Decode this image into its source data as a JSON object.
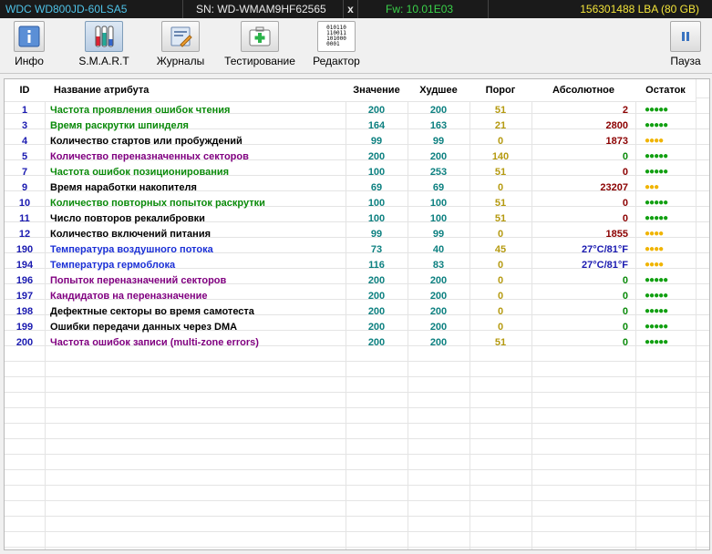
{
  "status_bar": {
    "model": "WDC WD800JD-60LSA5",
    "serial": "SN: WD-WMAM9HF62565",
    "close": "x",
    "firmware": "Fw: 10.01E03",
    "capacity": "156301488 LBA (80 GB)"
  },
  "toolbar": {
    "info": "Инфо",
    "smart": "S.M.A.R.T",
    "journals": "Журналы",
    "testing": "Тестирование",
    "editor": "Редактор",
    "pause": "Пауза",
    "editor_icon_text": [
      "010110",
      "110011",
      "101000",
      "0001"
    ]
  },
  "table": {
    "headers": {
      "id": "ID",
      "name": "Название атрибута",
      "value": "Значение",
      "worst": "Худшее",
      "threshold": "Порог",
      "raw": "Абсолютное",
      "remaining": "Остаток"
    },
    "rows": [
      {
        "id": "1",
        "name": "Частота проявления ошибок чтения",
        "value": "200",
        "worst": "200",
        "threshold": "51",
        "raw": "2",
        "remaining": "●●●●●",
        "name_color": "green",
        "raw_style": "red",
        "rem_color": "green"
      },
      {
        "id": "3",
        "name": "Время раскрутки шпинделя",
        "value": "164",
        "worst": "163",
        "threshold": "21",
        "raw": "2800",
        "remaining": "●●●●●",
        "name_color": "green",
        "raw_style": "red",
        "rem_color": "green"
      },
      {
        "id": "4",
        "name": "Количество стартов или пробуждений",
        "value": "99",
        "worst": "99",
        "threshold": "0",
        "raw": "1873",
        "remaining": "●●●●",
        "name_color": "black",
        "raw_style": "red",
        "rem_color": "yellow"
      },
      {
        "id": "5",
        "name": "Количество переназначенных секторов",
        "value": "200",
        "worst": "200",
        "threshold": "140",
        "raw": "0",
        "remaining": "●●●●●",
        "name_color": "purple",
        "raw_style": "ok",
        "rem_color": "green"
      },
      {
        "id": "7",
        "name": "Частота ошибок позиционирования",
        "value": "100",
        "worst": "253",
        "threshold": "51",
        "raw": "0",
        "remaining": "●●●●●",
        "name_color": "green",
        "raw_style": "red",
        "rem_color": "green"
      },
      {
        "id": "9",
        "name": "Время наработки накопителя",
        "value": "69",
        "worst": "69",
        "threshold": "0",
        "raw": "23207",
        "remaining": "●●●",
        "name_color": "black",
        "raw_style": "red",
        "rem_color": "yellow"
      },
      {
        "id": "10",
        "name": "Количество повторных попыток раскрутки",
        "value": "100",
        "worst": "100",
        "threshold": "51",
        "raw": "0",
        "remaining": "●●●●●",
        "name_color": "green",
        "raw_style": "red",
        "rem_color": "green"
      },
      {
        "id": "11",
        "name": "Число повторов рекалибровки",
        "value": "100",
        "worst": "100",
        "threshold": "51",
        "raw": "0",
        "remaining": "●●●●●",
        "name_color": "black",
        "raw_style": "red",
        "rem_color": "green"
      },
      {
        "id": "12",
        "name": "Количество включений питания",
        "value": "99",
        "worst": "99",
        "threshold": "0",
        "raw": "1855",
        "remaining": "●●●●",
        "name_color": "black",
        "raw_style": "red",
        "rem_color": "yellow"
      },
      {
        "id": "190",
        "name": "Температура воздушного потока",
        "value": "73",
        "worst": "40",
        "threshold": "45",
        "raw": "27°C/81°F",
        "remaining": "●●●●",
        "name_color": "blue",
        "raw_style": "temp",
        "rem_color": "yellow"
      },
      {
        "id": "194",
        "name": "Температура гермоблока",
        "value": "116",
        "worst": "83",
        "threshold": "0",
        "raw": "27°C/81°F",
        "remaining": "●●●●",
        "name_color": "blue",
        "raw_style": "temp",
        "rem_color": "yellow"
      },
      {
        "id": "196",
        "name": "Попыток переназначений секторов",
        "value": "200",
        "worst": "200",
        "threshold": "0",
        "raw": "0",
        "remaining": "●●●●●",
        "name_color": "purple",
        "raw_style": "ok",
        "rem_color": "green"
      },
      {
        "id": "197",
        "name": "Кандидатов на переназначение",
        "value": "200",
        "worst": "200",
        "threshold": "0",
        "raw": "0",
        "remaining": "●●●●●",
        "name_color": "purple",
        "raw_style": "ok",
        "rem_color": "green"
      },
      {
        "id": "198",
        "name": "Дефектные секторы во время самотеста",
        "value": "200",
        "worst": "200",
        "threshold": "0",
        "raw": "0",
        "remaining": "●●●●●",
        "name_color": "black",
        "raw_style": "ok",
        "rem_color": "green"
      },
      {
        "id": "199",
        "name": "Ошибки передачи данных через DMA",
        "value": "200",
        "worst": "200",
        "threshold": "0",
        "raw": "0",
        "remaining": "●●●●●",
        "name_color": "black",
        "raw_style": "ok",
        "rem_color": "green"
      },
      {
        "id": "200",
        "name": "Частота ошибок записи (multi-zone errors)",
        "value": "200",
        "worst": "200",
        "threshold": "51",
        "raw": "0",
        "remaining": "●●●●●",
        "name_color": "purple",
        "raw_style": "ok",
        "rem_color": "green"
      }
    ]
  },
  "colors": {
    "green": "#0a8a0a",
    "purple": "#800080",
    "blue": "#1a2fd6",
    "value_teal": "#0d8080",
    "threshold_olive": "#b59a10",
    "raw_red": "#8b0000",
    "dot_green": "#12a012",
    "dot_yellow": "#f0b400"
  }
}
